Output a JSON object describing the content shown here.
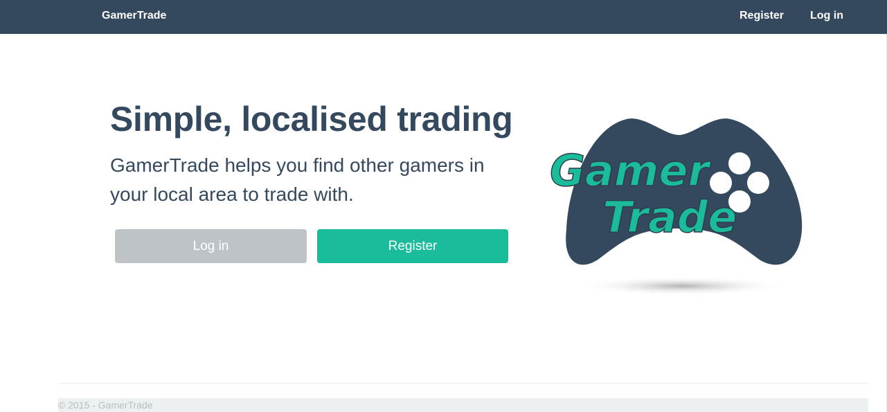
{
  "navbar": {
    "brand": "GamerTrade",
    "links": {
      "register": "Register",
      "login": "Log in"
    },
    "background": "#34495e"
  },
  "hero": {
    "title": "Simple, localised trading",
    "description": "GamerTrade helps you find other gamers in your local area to trade with.",
    "buttons": {
      "login": "Log in",
      "register": "Register"
    }
  },
  "logo": {
    "line1": "Gamer",
    "line2": "Trade",
    "icon": "gamepad-logo",
    "controller_color": "#34495e",
    "text_color": "#1abc9c"
  },
  "footer": {
    "copyright": "© 2015 - GamerTrade"
  },
  "colors": {
    "primary_dark": "#34495e",
    "accent": "#1abc9c",
    "muted_button": "#bdc3c7"
  }
}
